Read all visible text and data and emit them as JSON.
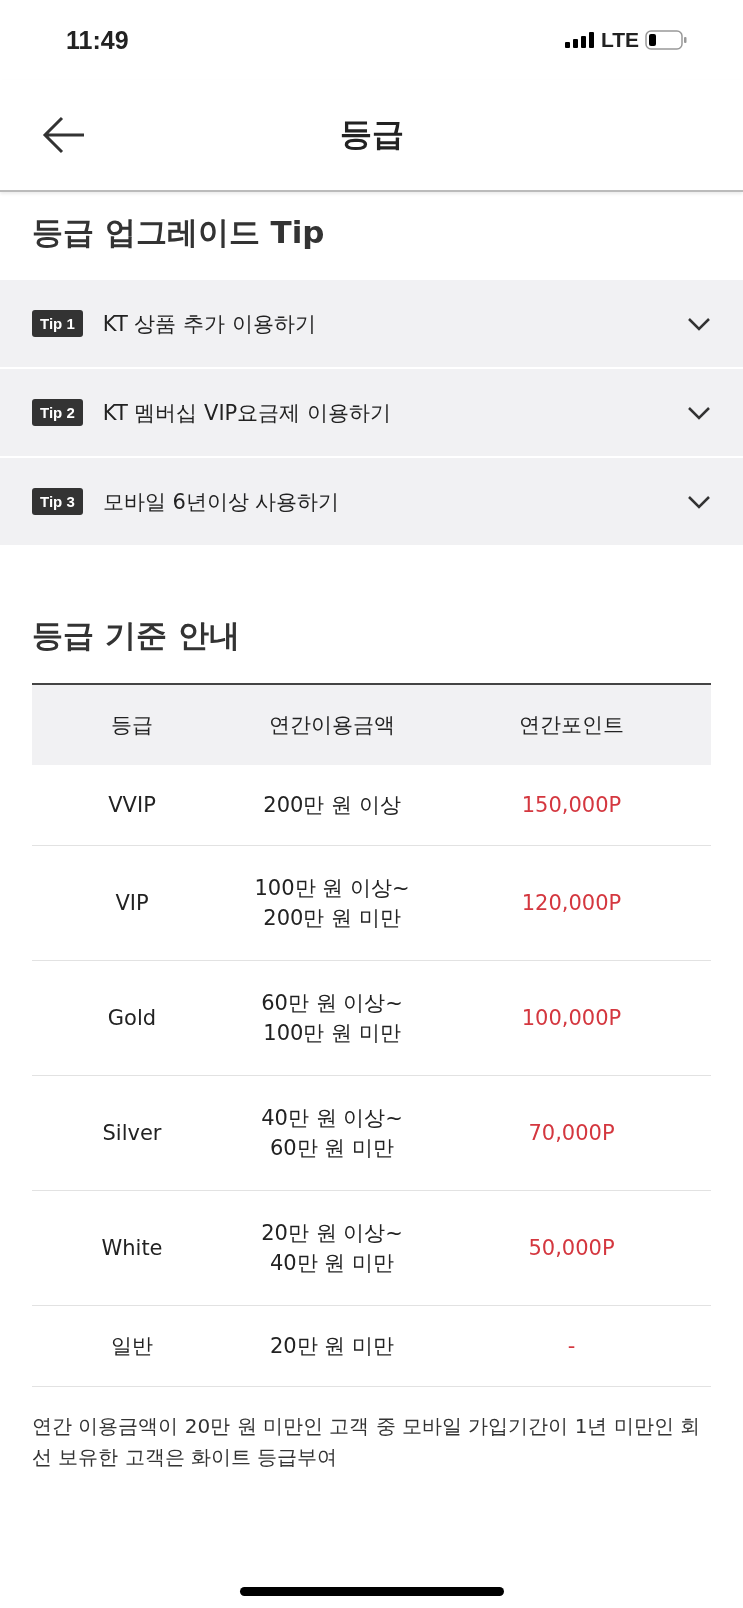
{
  "status_bar": {
    "time": "11:49",
    "network": "LTE"
  },
  "header": {
    "title": "등급"
  },
  "tips": {
    "title": "등급 업그레이드 Tip",
    "items": [
      {
        "badge": "Tip 1",
        "label": "KT 상품 추가 이용하기",
        "expanded": false
      },
      {
        "badge": "Tip 2",
        "label": "KT 멤버십 VIP요금제 이용하기",
        "expanded": false
      },
      {
        "badge": "Tip 3",
        "label": "모바일 6년이상 사용하기",
        "expanded": false
      }
    ]
  },
  "criteria": {
    "title": "등급 기준 안내",
    "columns": [
      "등급",
      "연간이용금액",
      "연간포인트"
    ],
    "rows": [
      {
        "grade": "VVIP",
        "amount": [
          "200만 원 이상"
        ],
        "points": "150,000P"
      },
      {
        "grade": "VIP",
        "amount": [
          "100만 원 이상~",
          "200만 원 미만"
        ],
        "points": "120,000P"
      },
      {
        "grade": "Gold",
        "amount": [
          "60만 원 이상~",
          "100만 원 미만"
        ],
        "points": "100,000P"
      },
      {
        "grade": "Silver",
        "amount": [
          "40만 원 이상~",
          "60만 원 미만"
        ],
        "points": "70,000P"
      },
      {
        "grade": "White",
        "amount": [
          "20만 원 이상~",
          "40만 원 미만"
        ],
        "points": "50,000P"
      },
      {
        "grade": "일반",
        "amount": [
          "20만 원 미만"
        ],
        "points": "-"
      }
    ],
    "note": "연간 이용금액이 20만 원 미만인 고객 중 모바일 가입기간이 1년 미만인 회선 보유한 고객은 화이트 등급부여"
  }
}
